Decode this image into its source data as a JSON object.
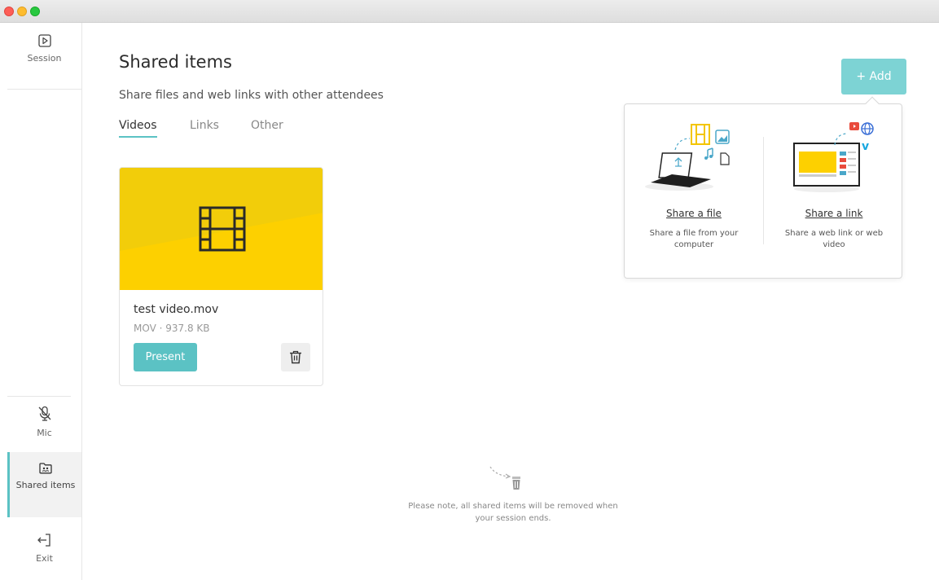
{
  "window": {
    "controls": [
      "close",
      "minimize",
      "maximize"
    ]
  },
  "sidebar": {
    "items": [
      {
        "label": "Session",
        "icon": "play-square-icon"
      },
      {
        "label": "Mic",
        "icon": "mic-off-icon"
      },
      {
        "label": "Shared items",
        "icon": "shared-folder-icon",
        "active": true
      },
      {
        "label": "Exit",
        "icon": "exit-icon"
      }
    ]
  },
  "main": {
    "title": "Shared items",
    "subtitle": "Share files and web links with other attendees",
    "tabs": [
      {
        "label": "Videos",
        "active": true
      },
      {
        "label": "Links",
        "active": false
      },
      {
        "label": "Other",
        "active": false
      }
    ],
    "add_button": "+ Add",
    "card": {
      "name": "test video.mov",
      "meta": "MOV · 937.8 KB",
      "present_label": "Present",
      "thumbnail_icon": "film-icon"
    },
    "notice": "Please note, all shared items will be removed when your session ends."
  },
  "popover": {
    "share_file": {
      "title": "Share a file",
      "description": "Share a file from your computer"
    },
    "share_link": {
      "title": "Share a link",
      "description": "Share a web link or web video"
    }
  },
  "colors": {
    "accent": "#5bc2c4",
    "add_button": "#7dd3d4",
    "thumb_yellow": "#fdd000",
    "thumb_yellow_dark": "#f2cd0a"
  }
}
